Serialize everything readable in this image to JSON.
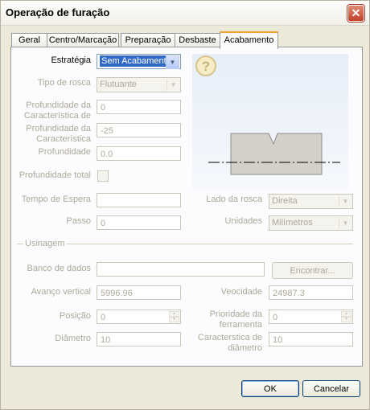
{
  "window": {
    "title": "Operação de furação",
    "close_glyph": "✕"
  },
  "tabs": [
    "Geral",
    "Centro/Marcação",
    "Preparação",
    "Desbaste",
    "Acabamento"
  ],
  "active_tab": "Acabamento",
  "fields": {
    "estrategia": {
      "label": "Estratégia",
      "value": "Sem Acabamento"
    },
    "tipo_rosca": {
      "label": "Tipo de rosca",
      "value": "Flutuante"
    },
    "prof_caracteristica_de": {
      "label_line1": "Profundidade da",
      "label_line2": "Característica de",
      "value": "0"
    },
    "prof_caracteristica": {
      "label_line1": "Profundidade da",
      "label_line2": "Característica",
      "value": "-25"
    },
    "profundidade": {
      "label": "Profundidade",
      "value": "0.0"
    },
    "profundidade_total": {
      "label": "Profundidade total"
    },
    "tempo_espera": {
      "label": "Tempo de Espera",
      "value": ""
    },
    "passo": {
      "label": "Passo",
      "value": "0"
    },
    "lado_rosca": {
      "label": "Lado da rosca",
      "value": "Direita"
    },
    "unidades": {
      "label": "Unidades",
      "value": "Milímetros"
    }
  },
  "usinagem": {
    "group_label": "Usinagem",
    "banco_dados": {
      "label": "Banco de dados",
      "value": ""
    },
    "encontrar_button": "Encontrar...",
    "avanco_vertical": {
      "label": "Avanço vertical",
      "value": "5996.96"
    },
    "velocidade": {
      "label": "Veocidade",
      "value": "24987.3"
    },
    "posicao": {
      "label": "Posição",
      "value": "0"
    },
    "prioridade": {
      "label_line1": "Prioridade da",
      "label_line2": "ferramenta",
      "value": "0"
    },
    "diametro": {
      "label": "Diâmetro",
      "value": "10"
    },
    "caracteristica_diametro": {
      "label_line1": "Caracterstica de",
      "label_line2": "diâmetro",
      "value": "10"
    }
  },
  "buttons": {
    "ok": "OK",
    "cancel": "Cancelar"
  },
  "preview": {
    "help_glyph": "?"
  },
  "colors": {
    "accent_tab": "#f2a133",
    "selection": "#316ac5",
    "disabled_text": "#aca899"
  }
}
